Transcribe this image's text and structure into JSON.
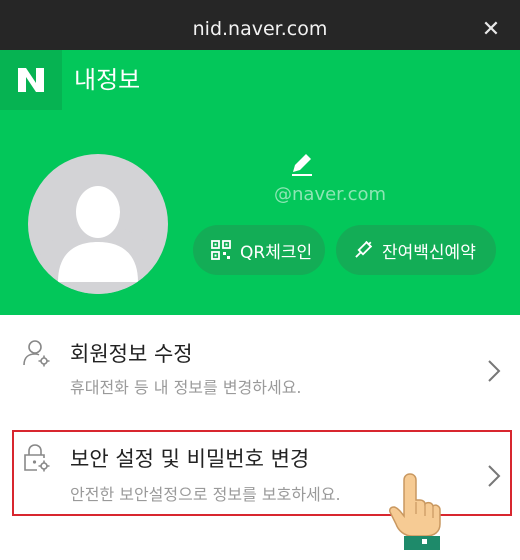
{
  "titlebar": {
    "url": "nid.naver.com",
    "close_icon": "close-icon"
  },
  "header": {
    "logo": "N",
    "title": "내정보"
  },
  "profile": {
    "email": "@naver.com",
    "qr_button": "QR체크인",
    "vaccine_button": "잔여백신예약"
  },
  "menu": {
    "items": [
      {
        "title": "회원정보 수정",
        "description": "휴대전화 등 내 정보를 변경하세요.",
        "icon": "user-gear-icon"
      },
      {
        "title": "보안 설정 및 비밀번호 변경",
        "description": "안전한 보안설정으로 정보를 보호하세요.",
        "icon": "lock-settings-icon"
      }
    ]
  },
  "colors": {
    "brand_green": "#03c75a",
    "titlebar": "#262626",
    "highlight_red": "#d8262f"
  }
}
